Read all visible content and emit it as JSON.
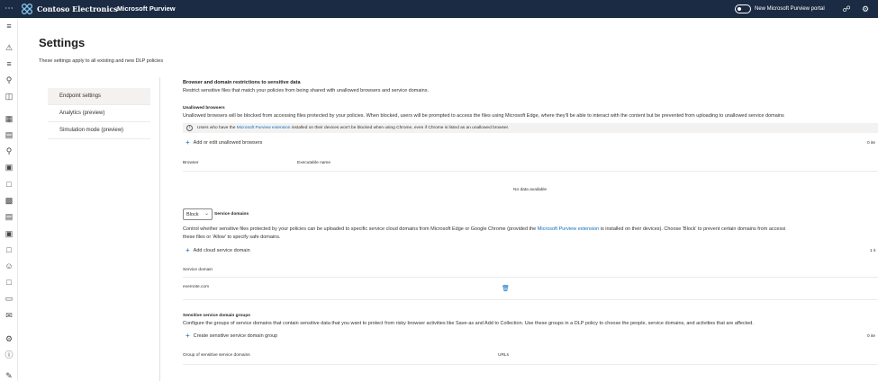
{
  "topbar": {
    "waffle_icon": "waffle-icon",
    "org_name": "Contoso Electronics",
    "app_name": "Microsoft Purview",
    "portal_toggle_label": "New Microsoft Purview portal",
    "icons": [
      "share-icon",
      "gear-icon"
    ]
  },
  "rail": {
    "icons": [
      "hamburger-icon",
      "alert-icon",
      "policy-icon",
      "search-icon",
      "inbox-icon",
      "grid-icon",
      "report-icon",
      "search-icon",
      "chat-icon",
      "document-icon",
      "building-icon",
      "archive-icon",
      "lock-icon",
      "document-search-icon",
      "person-icon",
      "document-lock-icon",
      "trash-icon",
      "mail-icon",
      "settings-icon",
      "info-icon",
      "edit-icon"
    ]
  },
  "page": {
    "title": "Settings",
    "subtitle": "These settings apply to all existing and new DLP policies"
  },
  "settings_nav": {
    "items": [
      {
        "label": "Endpoint settings",
        "active": true
      },
      {
        "label": "Analytics (preview)",
        "active": false
      },
      {
        "label": "Simulation mode (preview)",
        "active": false
      }
    ]
  },
  "browser_section": {
    "title": "Browser and domain restrictions to sensitive data",
    "description": "Restrict sensitive files that match your policies from being shared with unallowed browsers and service domains."
  },
  "unallowed_browsers": {
    "title": "Unallowed browsers",
    "description": "Unallowed browsers will be blocked from accessing files protected by your policies. When blocked, users will be prompted to access the files using Microsoft Edge, where they'll be able to interact with the content but be prevented from uploading to unallowed service domains",
    "info_prefix": "Users who have the ",
    "info_link": "Microsoft Purview extension",
    "info_suffix": " installed on their devices won't be blocked when using Chrome, even if Chrome is listed as an unallowed browser.",
    "add_label": "Add or edit unallowed browsers",
    "count": "0 ite",
    "columns": [
      "Browser",
      "Executable name"
    ],
    "empty_text": "No data available"
  },
  "service_domains": {
    "mode_value": "Block",
    "title": "Service domains",
    "description_prefix": "Control whether sensitive files protected by your policies can be uploaded to specific service cloud domains from Microsoft Edge or Google Chrome (provided the ",
    "description_link": "Microsoft Purview extension",
    "description_suffix": " is installed on their devices). Choose 'Block' to prevent certain domains from accessi",
    "description_line2": "these files or 'Allow' to specify safe domains.",
    "add_label": "Add cloud service domain",
    "count": "1 it",
    "column": "Service domain",
    "rows": [
      "evernote.com"
    ]
  },
  "sensitive_groups": {
    "title": "Sensitive service domain groups",
    "description": "Configure the groups of service domains that contain sensitive data that you want to protect from risky browser activities like Save-as and Add to Collection. Use these groups in a DLP policy to choose the people, service domains, and activities that are affected.",
    "add_label": "Create sensitive service domain group",
    "count": "0 ite",
    "columns": [
      "Group of sensitive service domains",
      "URLs"
    ]
  }
}
